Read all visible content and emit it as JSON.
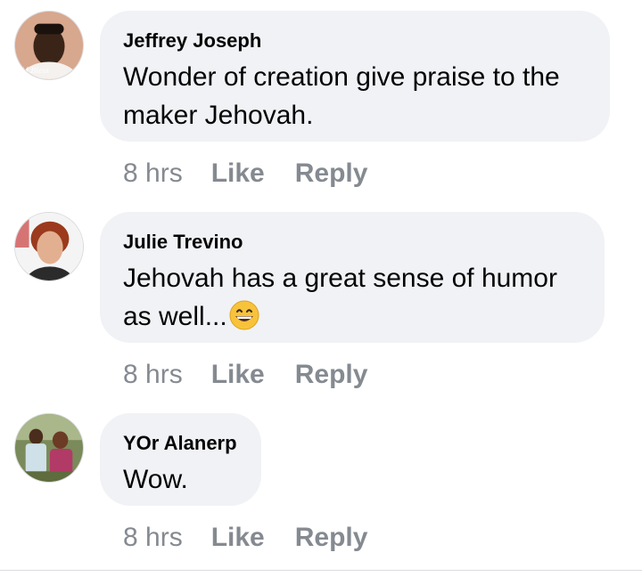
{
  "comments": [
    {
      "author": "Jeffrey Joseph",
      "text": "Wonder of creation give praise to the maker Jehovah.",
      "avatar_caption": "M Bless",
      "time": "8 hrs",
      "like_label": "Like",
      "reply_label": "Reply"
    },
    {
      "author": "Julie Trevino",
      "text": "Jehovah has a great sense of humor as well...",
      "emoji": "grinning-face-emoji",
      "time": "8 hrs",
      "like_label": "Like",
      "reply_label": "Reply"
    },
    {
      "author": "YOr Alanerp",
      "text": "Wow.",
      "time": "8 hrs",
      "like_label": "Like",
      "reply_label": "Reply"
    }
  ],
  "colors": {
    "bubble": "#f0f2f5",
    "text": "#050505",
    "meta": "#858a91"
  }
}
